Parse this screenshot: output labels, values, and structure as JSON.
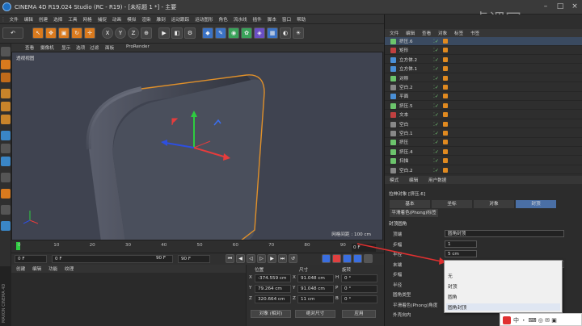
{
  "window": {
    "title": "CINEMA 4D R19.024 Studio (RC - R19) - [未标题 1 *] - 主要",
    "watermark": "虎课网"
  },
  "menubar": [
    "文件",
    "编辑",
    "创建",
    "选择",
    "工具",
    "网格",
    "捕捉",
    "动画",
    "模拟",
    "渲染",
    "雕刻",
    "运动跟踪",
    "运动图形",
    "角色",
    "流水线",
    "插件",
    "脚本",
    "窗口",
    "帮助"
  ],
  "toolbar": {
    "xyz": [
      "X",
      "Y",
      "Z"
    ]
  },
  "viewport": {
    "menu": [
      "查看",
      "摄像机",
      "显示",
      "选项",
      "过滤",
      "面板",
      "ProRender"
    ],
    "label": "透视视图",
    "grid_info": "网格间距 : 100 cm"
  },
  "timeline": {
    "ticks": [
      "0",
      "10",
      "20",
      "30",
      "40",
      "50",
      "60",
      "70",
      "80",
      "90"
    ],
    "current_frame": "0 F",
    "start": "0 F",
    "start2": "0 F",
    "end": "90 F",
    "end2": "90 F"
  },
  "material_menu": [
    "创建",
    "编辑",
    "功能",
    "纹理"
  ],
  "coords": {
    "headers": {
      "pos": "位置",
      "size": "尺寸",
      "rot": "旋转"
    },
    "rows": [
      {
        "axis": "X",
        "pos": "-374.559 cm",
        "size": "91.048 cm",
        "rlabel": "H",
        "rot": "0 °"
      },
      {
        "axis": "Y",
        "pos": "79.264 cm",
        "size": "91.048 cm",
        "rlabel": "P",
        "rot": "0 °"
      },
      {
        "axis": "Z",
        "pos": "320.664 cm",
        "size": "11 cm",
        "rlabel": "B",
        "rot": "0 °"
      }
    ],
    "mode1": "对象 (相对)",
    "mode2": "绝对尺寸",
    "apply": "应用"
  },
  "object_manager": {
    "menu": [
      "文件",
      "编辑",
      "查看",
      "对象",
      "标签",
      "书签"
    ],
    "items": [
      {
        "name": "挤压.6",
        "color": "#6cc46c"
      },
      {
        "name": "矩形",
        "color": "#c04040"
      },
      {
        "name": "立方体.2",
        "color": "#4a8fd6"
      },
      {
        "name": "立方体.1",
        "color": "#4a8fd6"
      },
      {
        "name": "对称",
        "color": "#6cc46c"
      },
      {
        "name": "空白.2",
        "color": "#888888"
      },
      {
        "name": "平面",
        "color": "#4a8fd6"
      },
      {
        "name": "挤压.5",
        "color": "#6cc46c"
      },
      {
        "name": "文本",
        "color": "#c04040"
      },
      {
        "name": "空白",
        "color": "#888888"
      },
      {
        "name": "空白.1",
        "color": "#888888"
      },
      {
        "name": "挤压",
        "color": "#6cc46c"
      },
      {
        "name": "挤压.4",
        "color": "#6cc46c"
      },
      {
        "name": "扫描",
        "color": "#6cc46c"
      },
      {
        "name": "空白.2",
        "color": "#888888"
      }
    ]
  },
  "attribute_manager": {
    "menu": [
      "模式",
      "编辑",
      "用户数据"
    ],
    "object_label": "拉伸对象 [挤压.6]",
    "tabs": [
      "基本",
      "坐标",
      "对象",
      "封顶"
    ],
    "subtab": "平滑着色(Phong)标签",
    "section": "封顶圆角",
    "rows": [
      {
        "label": "顶端",
        "value": "圆角封顶"
      },
      {
        "label": "步幅",
        "value": "1"
      },
      {
        "label": "半径",
        "value": "5 cm"
      },
      {
        "label": "末端",
        "value": "封顶"
      },
      {
        "label": "步幅",
        "value": ""
      },
      {
        "label": "半径",
        "value": ""
      },
      {
        "label": "圆角类型",
        "value": ""
      },
      {
        "label": "平滑着色(Phong)角度",
        "value": ""
      },
      {
        "label": "外壳向内",
        "value": ""
      }
    ]
  },
  "dropdown": {
    "options": [
      "无",
      "封顶",
      "圆角",
      "圆角封顶"
    ],
    "hovered": "圆角封顶"
  },
  "side_label": "MAXON CINEMA 4D"
}
